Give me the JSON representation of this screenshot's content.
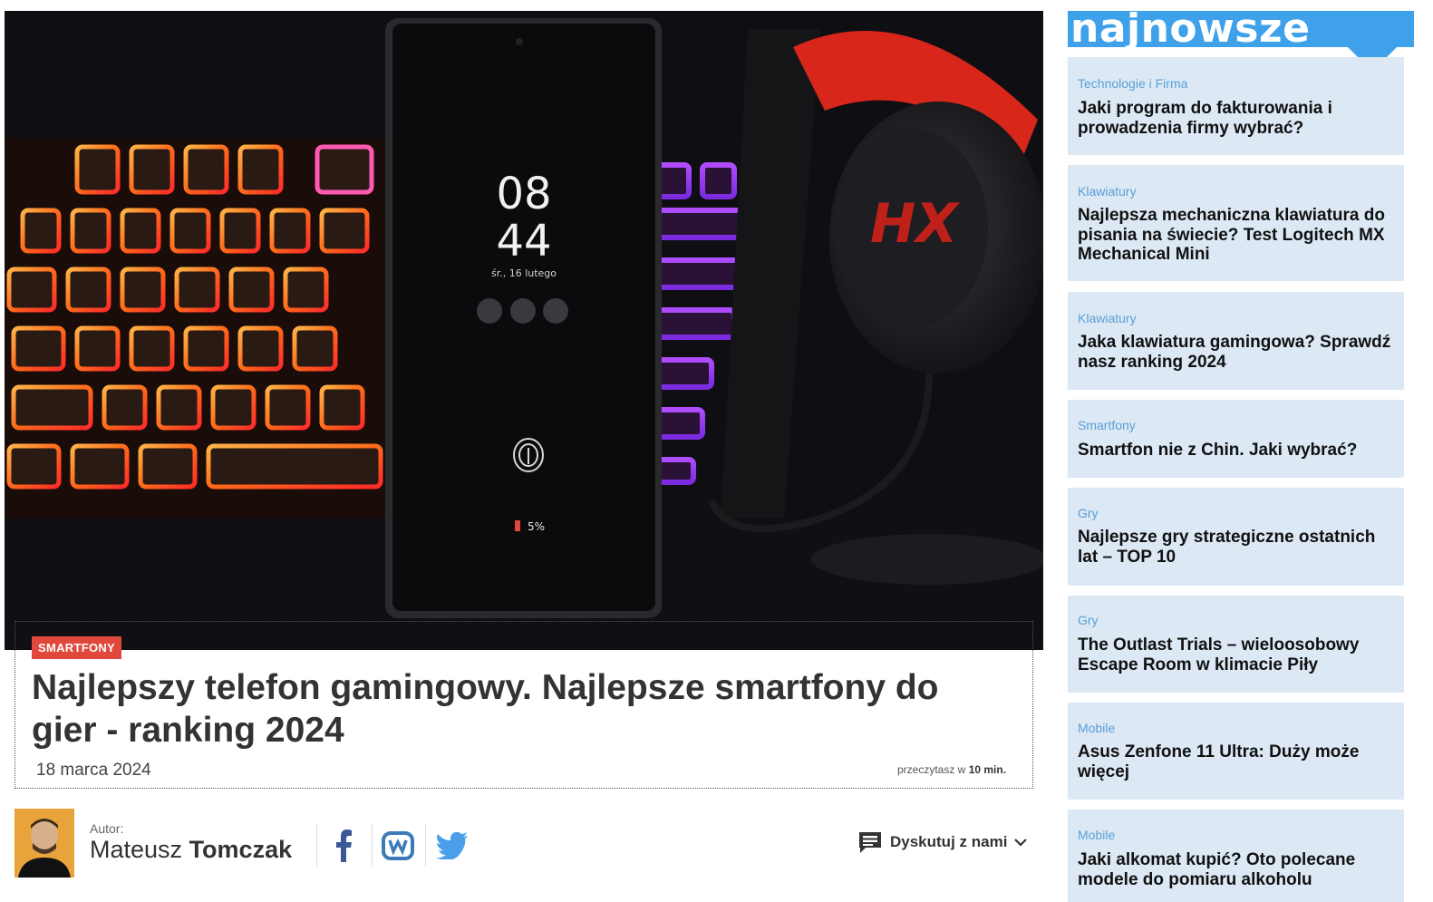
{
  "hero": {
    "phone_time_hour": "08",
    "phone_time_minute": "44",
    "phone_date": "śr., 16 lutego",
    "phone_battery": "5%",
    "headphone_brand": "HX"
  },
  "article": {
    "category": "SMARTFONY",
    "title": "Najlepszy telefon gamingowy. Najlepsze smartfony do gier - ranking 2024",
    "date": "18 marca 2024",
    "read_prefix": "przeczytasz w",
    "read_time": "10 min."
  },
  "author": {
    "label": "Autor:",
    "first_name": "Mateusz",
    "last_name": "Tomczak"
  },
  "social": {
    "icons": [
      "facebook-icon",
      "wykop-icon",
      "twitter-icon"
    ]
  },
  "discuss": {
    "label": "Dyskutuj z nami"
  },
  "sidebar": {
    "heading": "najnowsze",
    "items": [
      {
        "category": "Technologie i Firma",
        "title": "Jaki program do fakturowania i prowadzenia firmy wybrać?"
      },
      {
        "category": "Klawiatury",
        "title": "Najlepsza mechaniczna klawiatura do pisania na świecie? Test Logitech MX Mechanical Mini"
      },
      {
        "category": "Klawiatury",
        "title": "Jaka klawiatura gamingowa? Sprawdź nasz ranking 2024"
      },
      {
        "category": "Smartfony",
        "title": "Smartfon nie z Chin. Jaki wybrać?"
      },
      {
        "category": "Gry",
        "title": "Najlepsze gry strategiczne ostatnich lat – TOP 10"
      },
      {
        "category": "Gry",
        "title": "The Outlast Trials – wieloosobowy Escape Room w klimacie Piły"
      },
      {
        "category": "Mobile",
        "title": "Asus Zenfone 11 Ultra: Duży może więcej"
      },
      {
        "category": "Mobile",
        "title": "Jaki alkomat kupić? Oto polecane modele do pomiaru alkoholu"
      }
    ]
  },
  "colors": {
    "accent": "#3fa1ea",
    "badge": "#e0483b",
    "card_bg": "#dce9f5",
    "category_text": "#5a9fd6"
  }
}
